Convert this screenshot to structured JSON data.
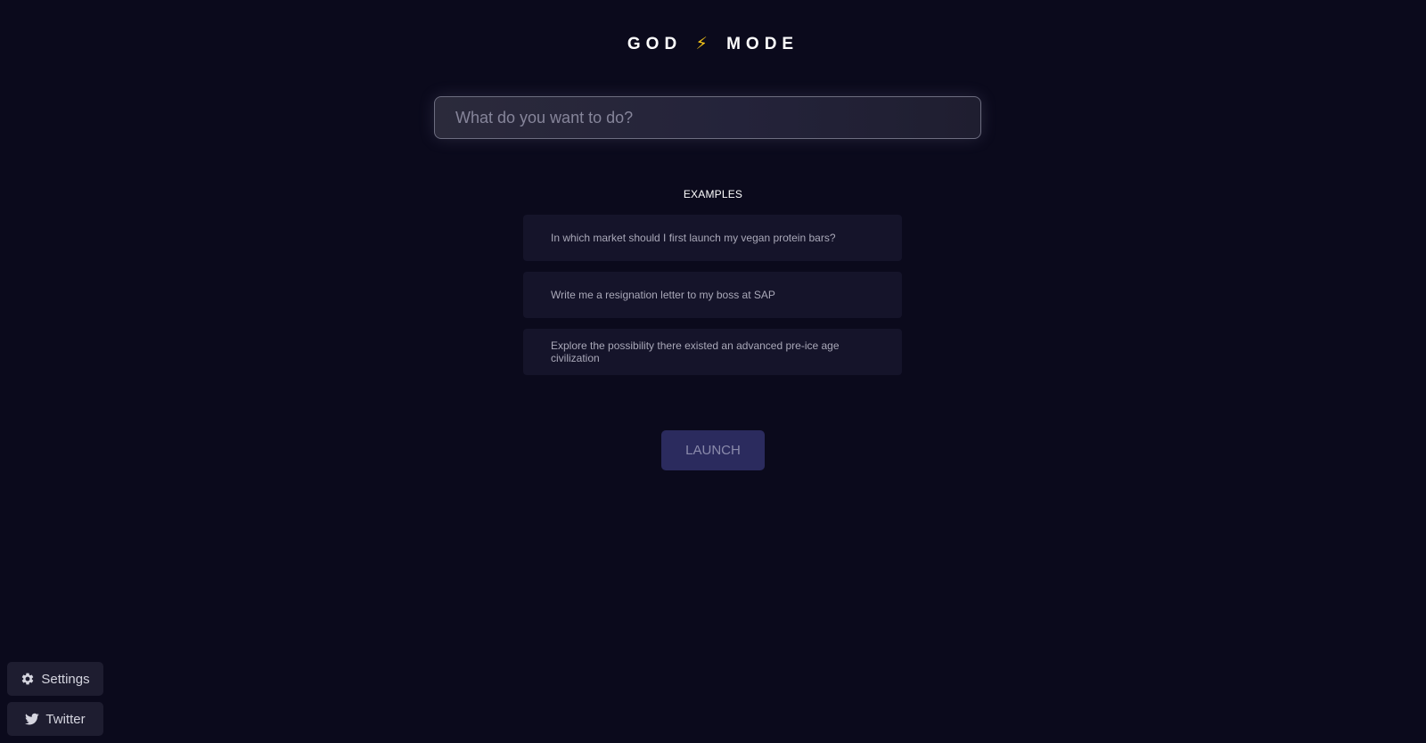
{
  "header": {
    "word1": "GOD",
    "bolt": "⚡",
    "word2": "MODE"
  },
  "search": {
    "placeholder": "What do you want to do?",
    "value": ""
  },
  "examples": {
    "title": "EXAMPLES",
    "items": [
      {
        "text": "In which market should I first launch my vegan protein bars?"
      },
      {
        "text": "Write me a resignation letter to my boss at SAP"
      },
      {
        "text": "Explore the possibility there existed an advanced pre-ice age civilization"
      }
    ]
  },
  "launch": {
    "label": "LAUNCH"
  },
  "footer": {
    "settings_label": "Settings",
    "settings_icon": "gear-icon",
    "twitter_label": "Twitter",
    "twitter_icon": "twitter-bird-icon"
  },
  "colors": {
    "background": "#0b0a1c",
    "card": "#15142a",
    "launch_bg": "#2b2b5e",
    "bolt": "#f5c518"
  }
}
